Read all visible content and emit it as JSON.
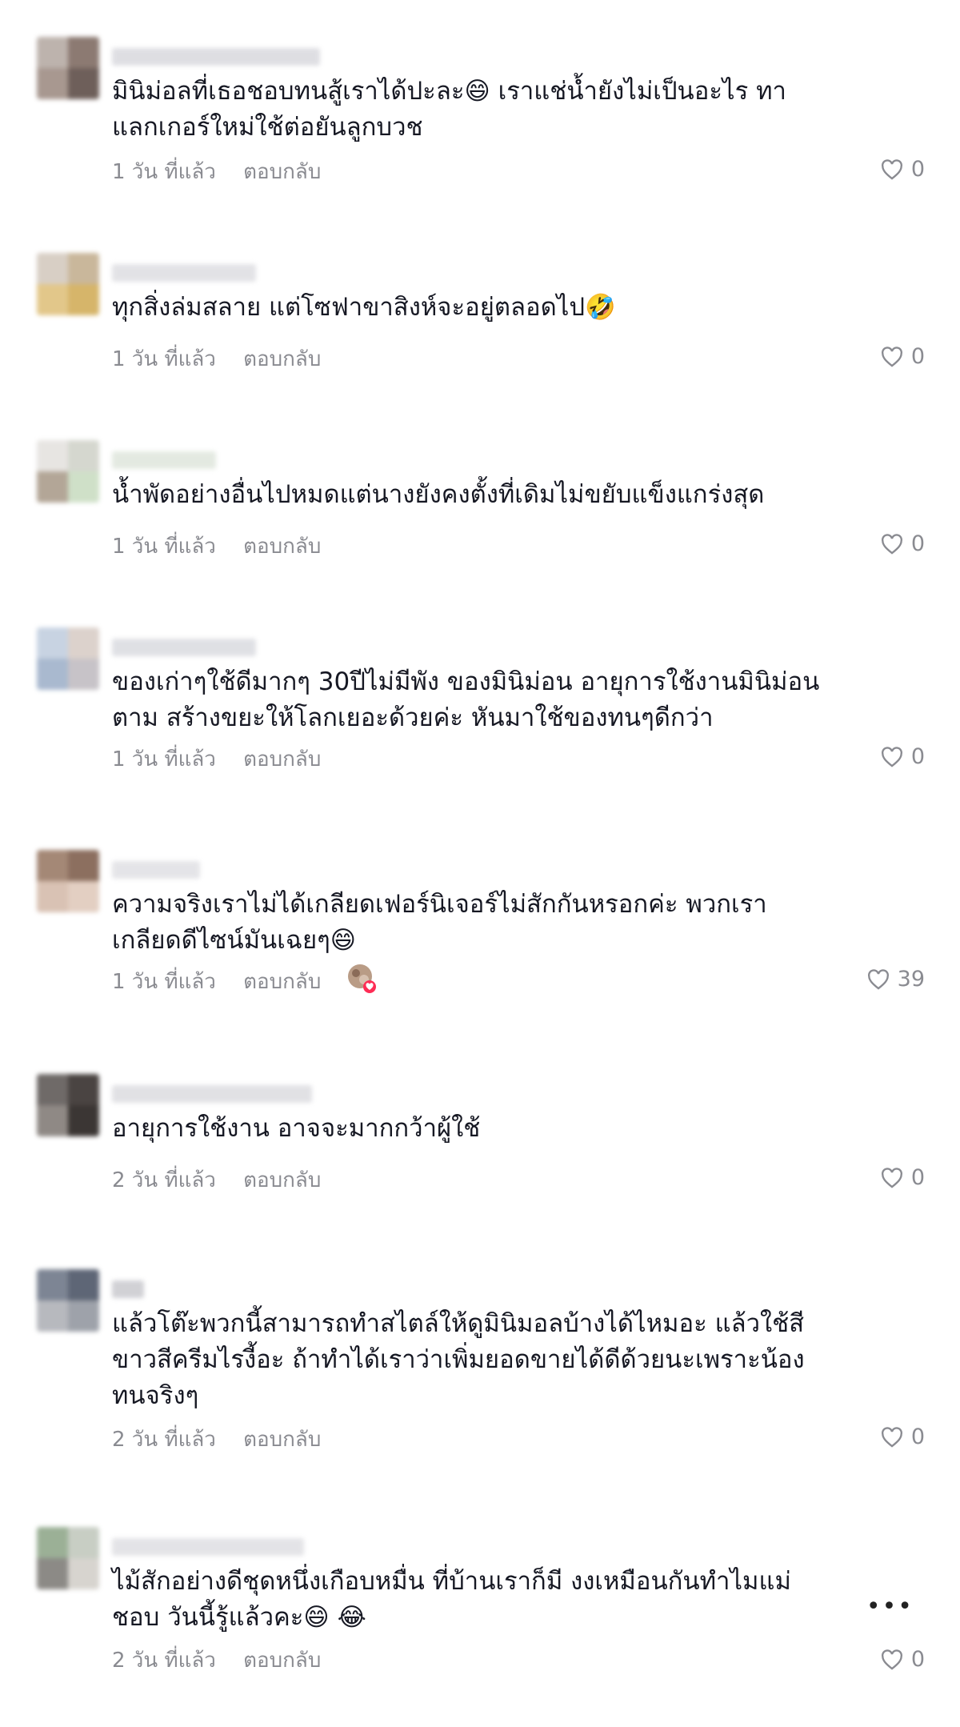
{
  "comments": [
    {
      "text": "มินิม่อลที่เธอชอบทนสู้เราได้ปะละ😄 เราแช่น้ำยังไม่เป็นอะไร ทา\nแลกเกอร์ใหม่ใช้ต่อยันลูกบวช",
      "time": "1 วัน ที่แล้ว",
      "reply": "ตอบกลับ",
      "likes": "0"
    },
    {
      "text": "ทุกสิ่งล่มสลาย แต่โซฟาขาสิงห์จะอยู่ตลอดไป🤣",
      "time": "1 วัน ที่แล้ว",
      "reply": "ตอบกลับ",
      "likes": "0"
    },
    {
      "text": "น้ำพัดอย่างอื่นไปหมดแต่นางยังคงตั้งที่เดิมไม่ขยับแข็งแกร่งสุด",
      "time": "1 วัน ที่แล้ว",
      "reply": "ตอบกลับ",
      "likes": "0"
    },
    {
      "text": "ของเก่าๆใช้ดีมากๆ 30ปีไม่มีพัง ของมินิม่อน อายุการใช้งานมินิม่อน\nตาม สร้างขยะให้โลกเยอะด้วยค่ะ หันมาใช้ของทนๆดีกว่า",
      "time": "1 วัน ที่แล้ว",
      "reply": "ตอบกลับ",
      "likes": "0"
    },
    {
      "text": "ความจริงเราไม่ได้เกลียดเฟอร์นิเจอร์ไม่สักกันหรอกค่ะ พวกเรา\nเกลียดดีไซน์มันเฉยๆ😄",
      "time": "1 วัน ที่แล้ว",
      "reply": "ตอบกลับ",
      "likes": "39"
    },
    {
      "text": "อายุการใช้งาน อาจจะมากกว้าผู้ใช้",
      "time": "2 วัน ที่แล้ว",
      "reply": "ตอบกลับ",
      "likes": "0"
    },
    {
      "text": "แล้วโต๊ะพวกนี้สามารถทำสไตล์ให้ดูมินิมอลบ้างได้ไหมอะ แล้วใช้สี\nขาวสีครีมไรงี้อะ ถ้าทำได้เราว่าเพิ่มยอดขายได้ดีด้วยนะเพราะน้อง\nทนจริงๆ",
      "time": "2 วัน ที่แล้ว",
      "reply": "ตอบกลับ",
      "likes": "0"
    },
    {
      "text": "ไม้สักอย่างดีชุดหนึ่งเกือบหมื่น ที่บ้านเราก็มี งงเหมือนกันทำไมแม่\nชอบ วันนี้รู้แล้วคะ😄 😂",
      "time": "2 วัน ที่แล้ว",
      "reply": "ตอบกลับ",
      "likes": "0"
    }
  ],
  "icons": {
    "like": "heart-outline-icon",
    "more": "more-options-icon",
    "badge": "liked-by-creator-icon"
  },
  "more_label": "•••"
}
